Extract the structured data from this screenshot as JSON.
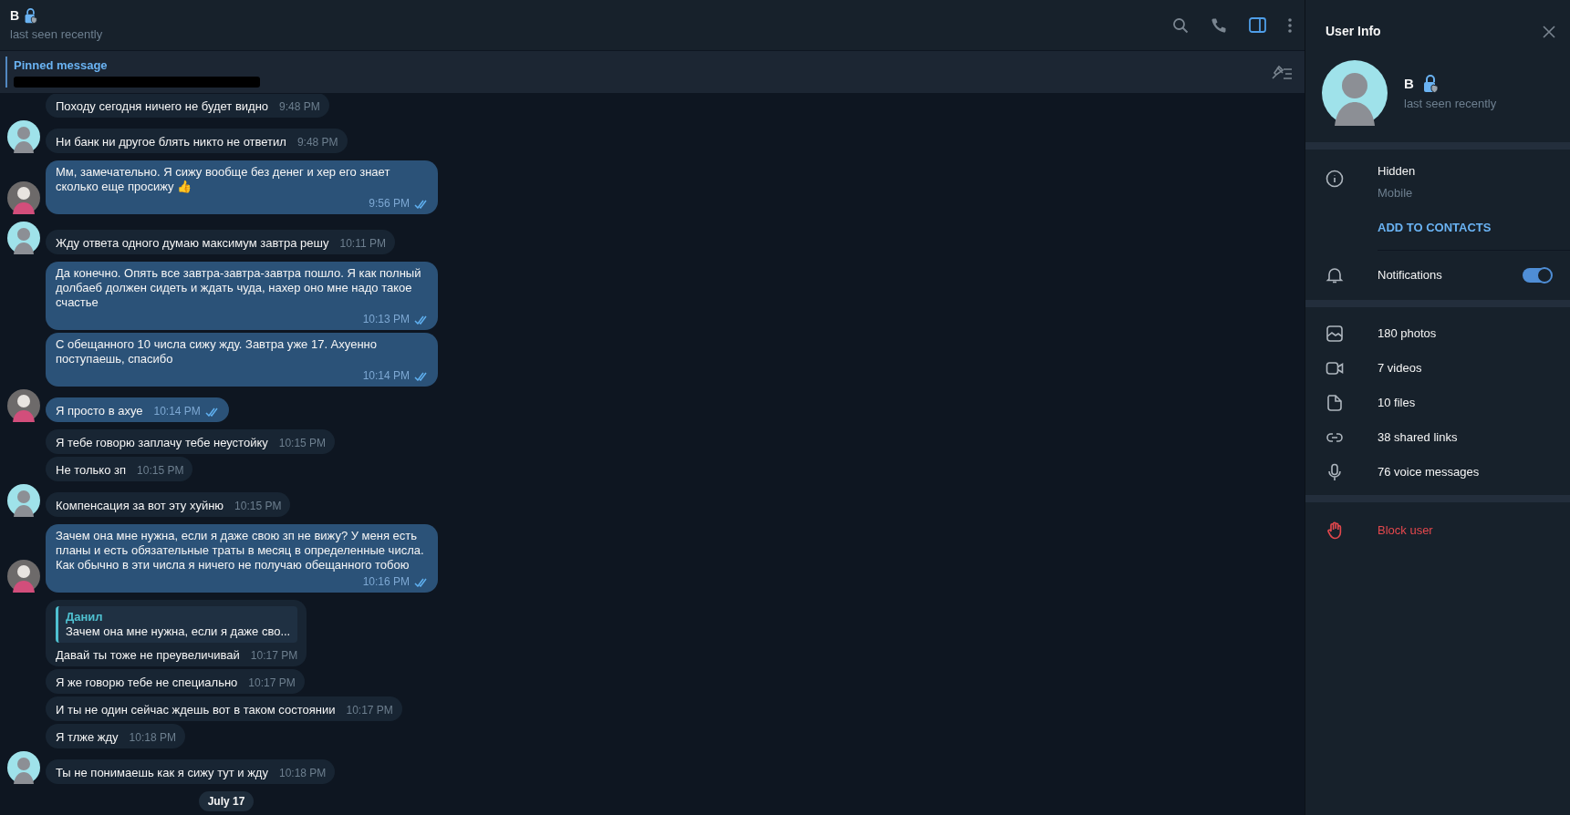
{
  "header": {
    "name": "B",
    "status": "last seen recently",
    "panel_toggle_on": true
  },
  "pinned": {
    "title": "Pinned message",
    "redacted": true
  },
  "messages": [
    {
      "kind": "in",
      "avatar_shown": false,
      "text": "Походу сегодня ничего не будет видно",
      "time": "9:48 PM"
    },
    {
      "kind": "in",
      "avatar_shown": true,
      "text": "Ни банк ни другое блять никто не ответил",
      "time": "9:48 PM"
    },
    {
      "kind": "out",
      "avatar_shown": true,
      "text": "Мм, замечательно. Я сижу вообще без денег и хер его знает сколько еще просижу 👍",
      "time": "9:56 PM",
      "read": true
    },
    {
      "kind": "in",
      "avatar_shown": true,
      "text": "Жду ответа одного думаю максимум завтра решу",
      "time": "10:11 PM"
    },
    {
      "kind": "out",
      "avatar_shown": false,
      "text": "Да конечно. Опять все завтра-завтра-завтра пошло. Я как полный долбаеб должен сидеть и ждать чуда, нахер оно мне надо такое счастье",
      "time": "10:13 PM",
      "read": true
    },
    {
      "kind": "out",
      "avatar_shown": false,
      "text": "С обещанного 10 числа сижу жду. Завтра уже 17. Ахуенно поступаешь, спасибо",
      "time": "10:14 PM",
      "read": true
    },
    {
      "kind": "out",
      "avatar_shown": true,
      "text": "Я просто в ахуе",
      "time": "10:14 PM",
      "read": true
    },
    {
      "kind": "in",
      "avatar_shown": false,
      "text": "Я тебе говорю заплачу тебе неустойку",
      "time": "10:15 PM"
    },
    {
      "kind": "in",
      "avatar_shown": false,
      "text": "Не только зп",
      "time": "10:15 PM"
    },
    {
      "kind": "in",
      "avatar_shown": true,
      "text": "Компенсация за вот эту хуйню",
      "time": "10:15 PM"
    },
    {
      "kind": "out",
      "avatar_shown": true,
      "text": "Зачем она мне нужна, если я даже свою зп не вижу? У меня есть планы и есть обязательные траты в месяц в определенные числа. Как обычно в эти числа я ничего не получаю обещанного тобою",
      "time": "10:16 PM",
      "read": true
    },
    {
      "kind": "in",
      "avatar_shown": false,
      "reply": {
        "name": "Данил",
        "text": "Зачем она мне нужна, если я даже сво..."
      },
      "text": "Давай ты тоже не преувеличивай",
      "time": "10:17 PM"
    },
    {
      "kind": "in",
      "avatar_shown": false,
      "text": "Я же говорю тебе не специально",
      "time": "10:17 PM"
    },
    {
      "kind": "in",
      "avatar_shown": false,
      "text": "И ты не один сейчас ждешь вот в таком состоянии",
      "time": "10:17 PM"
    },
    {
      "kind": "in",
      "avatar_shown": false,
      "text": "Я тлже жду",
      "time": "10:18 PM"
    },
    {
      "kind": "in",
      "avatar_shown": true,
      "text": "Ты не понимаешь как я сижу тут и жду",
      "time": "10:18 PM"
    }
  ],
  "date_badge": "July 17",
  "user_info": {
    "title": "User Info",
    "name": "B",
    "status": "last seen recently",
    "phone": "Hidden",
    "phone_label": "Mobile",
    "add_contact": "ADD TO CONTACTS",
    "notifications": {
      "label": "Notifications",
      "on": true
    },
    "media": [
      {
        "kind": "photos",
        "label": "180 photos"
      },
      {
        "kind": "videos",
        "label": "7 videos"
      },
      {
        "kind": "files",
        "label": "10 files"
      },
      {
        "kind": "links",
        "label": "38 shared links"
      },
      {
        "kind": "voice",
        "label": "76 voice messages"
      }
    ],
    "block": "Block user"
  }
}
